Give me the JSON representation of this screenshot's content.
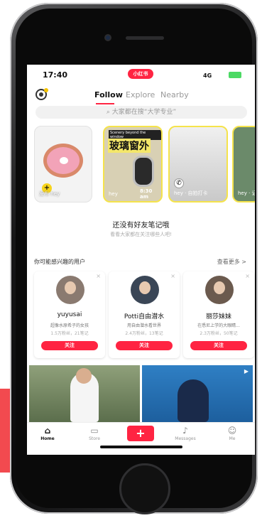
{
  "status_bar": {
    "time": "17:40",
    "brand": "小红书",
    "signal": "4G"
  },
  "nav": {
    "tabs": [
      {
        "label": "Follow",
        "active": true
      },
      {
        "label": "Explore",
        "active": false
      },
      {
        "label": "Nearby",
        "active": false
      }
    ],
    "search_placeholder": "大家都在搜“大学专业”"
  },
  "stories": {
    "me_caption": "发布 hey",
    "photo_sub": "Scenery beyond the window",
    "photo_title": "玻璃窗外",
    "photo_time": "8:30 am",
    "photo_caption": "hey",
    "grey_caption": "hey · 自拍打卡",
    "last_caption": "hey · 记"
  },
  "empty_state": {
    "title": "还没有好友笔记哦",
    "subtitle": "看看大家都在关注哪些人吧!"
  },
  "recommend": {
    "heading": "你可能感兴趣的用户",
    "more": "查看更多 >",
    "users": [
      {
        "name": "yuyusai",
        "desc": "超像水原希子的女孩",
        "stats": "1.5万粉丝，21笔记",
        "follow": "关注"
      },
      {
        "name": "Potti自由潜水",
        "desc": "用自由潜水看世界",
        "stats": "2.4万粉丝，13笔记",
        "follow": "关注"
      },
      {
        "name": "丽莎妹妹",
        "desc": "在悉尼上学的大眼睛...",
        "stats": "2.3万粉丝，50笔记",
        "follow": "关注"
      }
    ]
  },
  "tabbar": {
    "items": [
      {
        "label": "Home",
        "icon": "home-icon",
        "active": true
      },
      {
        "label": "Store",
        "icon": "store-icon",
        "active": false
      },
      {
        "label": "+",
        "icon": "plus-icon",
        "active": false
      },
      {
        "label": "Messages",
        "icon": "bell-icon",
        "active": false
      },
      {
        "label": "Me",
        "icon": "person-icon",
        "active": false
      }
    ]
  },
  "colors": {
    "accent": "#ff2442",
    "highlight": "#f5e34b",
    "side_block": "#f24a4f"
  }
}
